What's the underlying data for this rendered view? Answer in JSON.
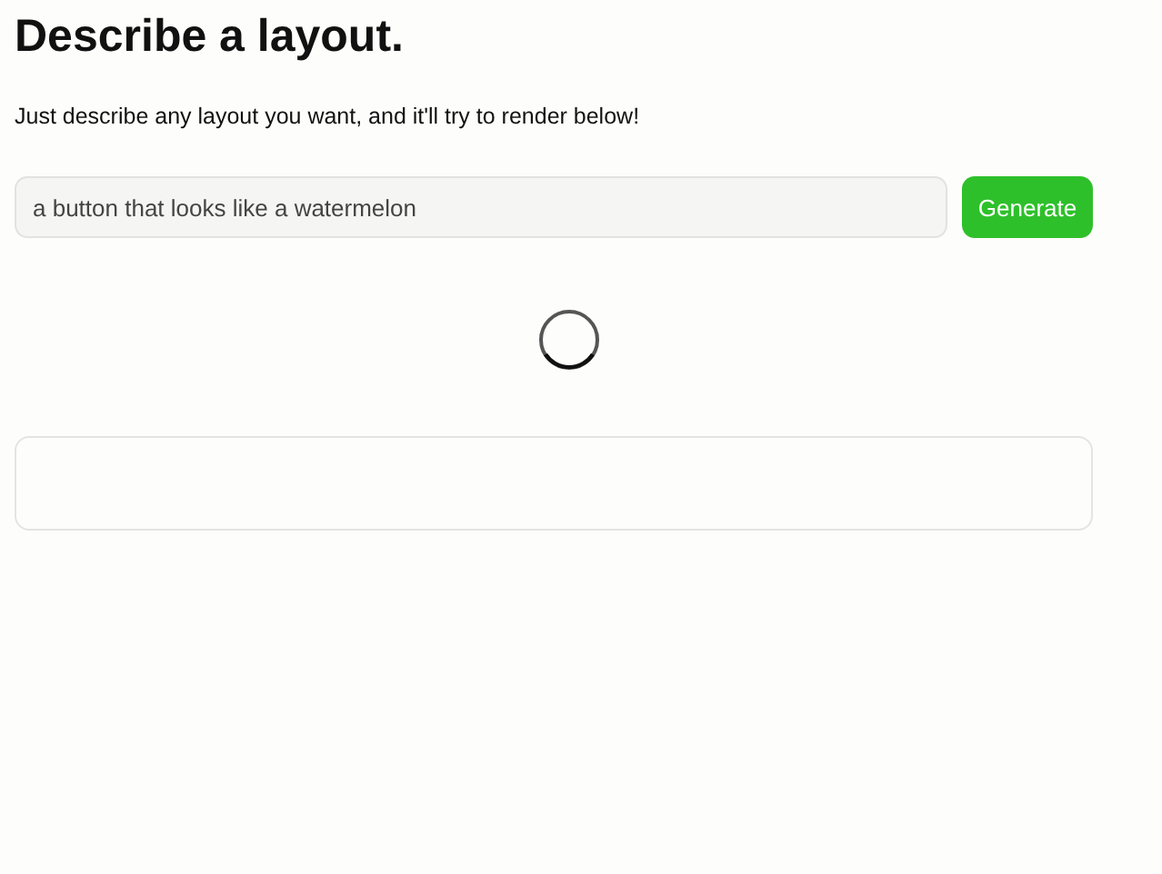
{
  "title": "Describe a layout.",
  "subtitle": "Just describe any layout you want, and it'll try to render below!",
  "prompt": {
    "value": "a button that looks like a watermelon"
  },
  "generate_button": "Generate",
  "output": {
    "loading": true
  }
}
